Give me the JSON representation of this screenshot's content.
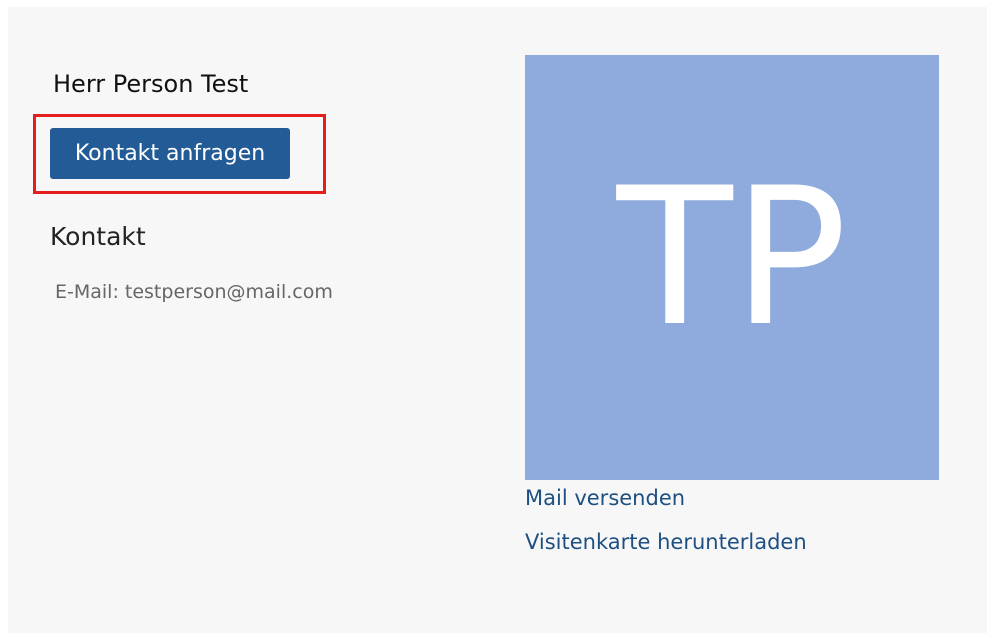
{
  "profile": {
    "name": "Herr Person Test",
    "contact_button_label": "Kontakt anfragen",
    "avatar_initials": "TP"
  },
  "contact": {
    "heading": "Kontakt",
    "email": "E-Mail: testperson@mail.com"
  },
  "links": {
    "send_mail": "Mail versenden",
    "download_vcard": "Visitenkarte herunterladen"
  },
  "colors": {
    "button_bg": "#235b96",
    "avatar_bg": "#8fabdd",
    "link": "#1d4f82",
    "highlight": "#e41e1e",
    "panel_bg": "#f7f7f7"
  }
}
